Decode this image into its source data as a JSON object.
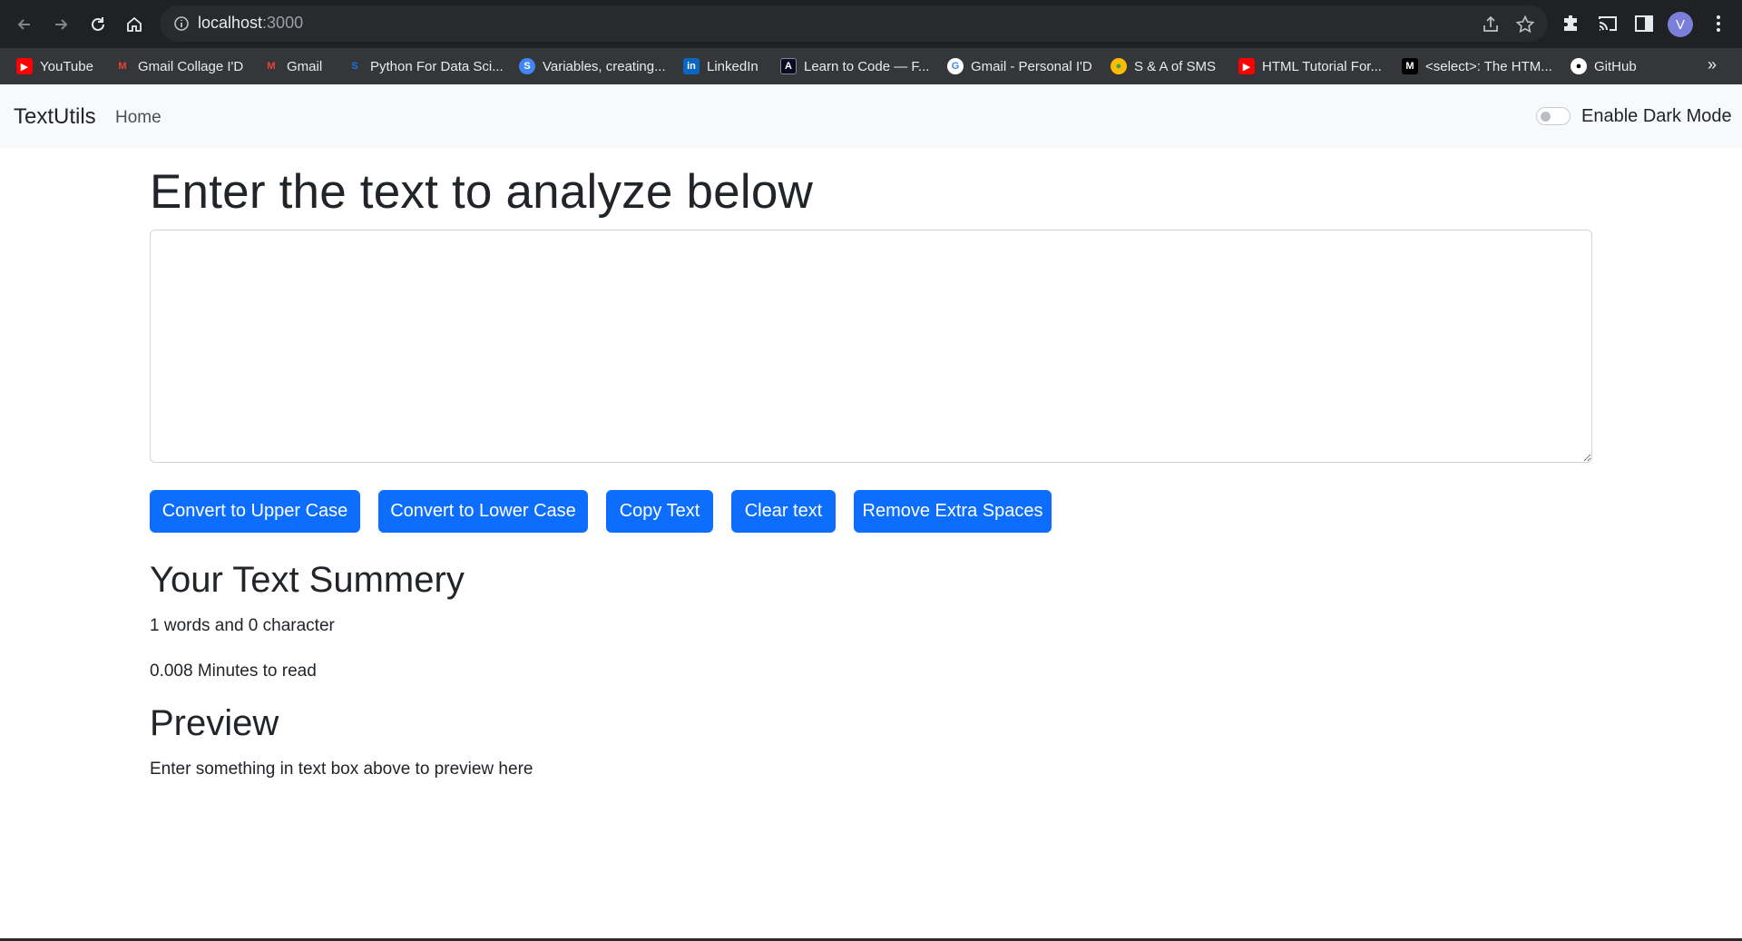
{
  "browser": {
    "url_host": "localhost",
    "url_port": ":3000",
    "profile_initial": "V"
  },
  "bookmarks": [
    {
      "label": "YouTube",
      "icon": "youtube-icon"
    },
    {
      "label": "Gmail Collage I'D",
      "icon": "gmail-icon"
    },
    {
      "label": "Gmail",
      "icon": "gmail-icon"
    },
    {
      "label": "Python For Data Sci...",
      "icon": "python-course-icon"
    },
    {
      "label": "Variables, creating...",
      "icon": "w3-icon"
    },
    {
      "label": "LinkedIn",
      "icon": "linkedin-icon"
    },
    {
      "label": "Learn to Code — F...",
      "icon": "freecodecamp-icon"
    },
    {
      "label": "Gmail - Personal I'D",
      "icon": "google-icon"
    },
    {
      "label": "S & A of SMS",
      "icon": "drive-icon"
    },
    {
      "label": "HTML Tutorial For...",
      "icon": "youtube-icon"
    },
    {
      "label": "<select>: The HTM...",
      "icon": "mdn-icon"
    },
    {
      "label": "GitHub",
      "icon": "github-icon"
    }
  ],
  "navbar": {
    "brand": "TextUtils",
    "home": "Home",
    "dark_mode_label": "Enable Dark Mode",
    "dark_mode_enabled": false
  },
  "main": {
    "title": "Enter the text to analyze below",
    "textarea_value": "",
    "buttons": [
      "Convert to Upper Case",
      "Convert to Lower Case",
      "Copy Text",
      "Clear text",
      "Remove Extra Spaces"
    ],
    "summary_heading": "Your Text Summery",
    "counts": "1 words and 0 character",
    "read_time": "0.008 Minutes to read",
    "preview_heading": "Preview",
    "preview_text": "Enter something in text box above to preview here"
  },
  "colors": {
    "primary": "#0d6efd",
    "browser_dark": "#202124",
    "bookmark_bar": "#35363a",
    "navbar_bg": "#f8f9fa"
  }
}
